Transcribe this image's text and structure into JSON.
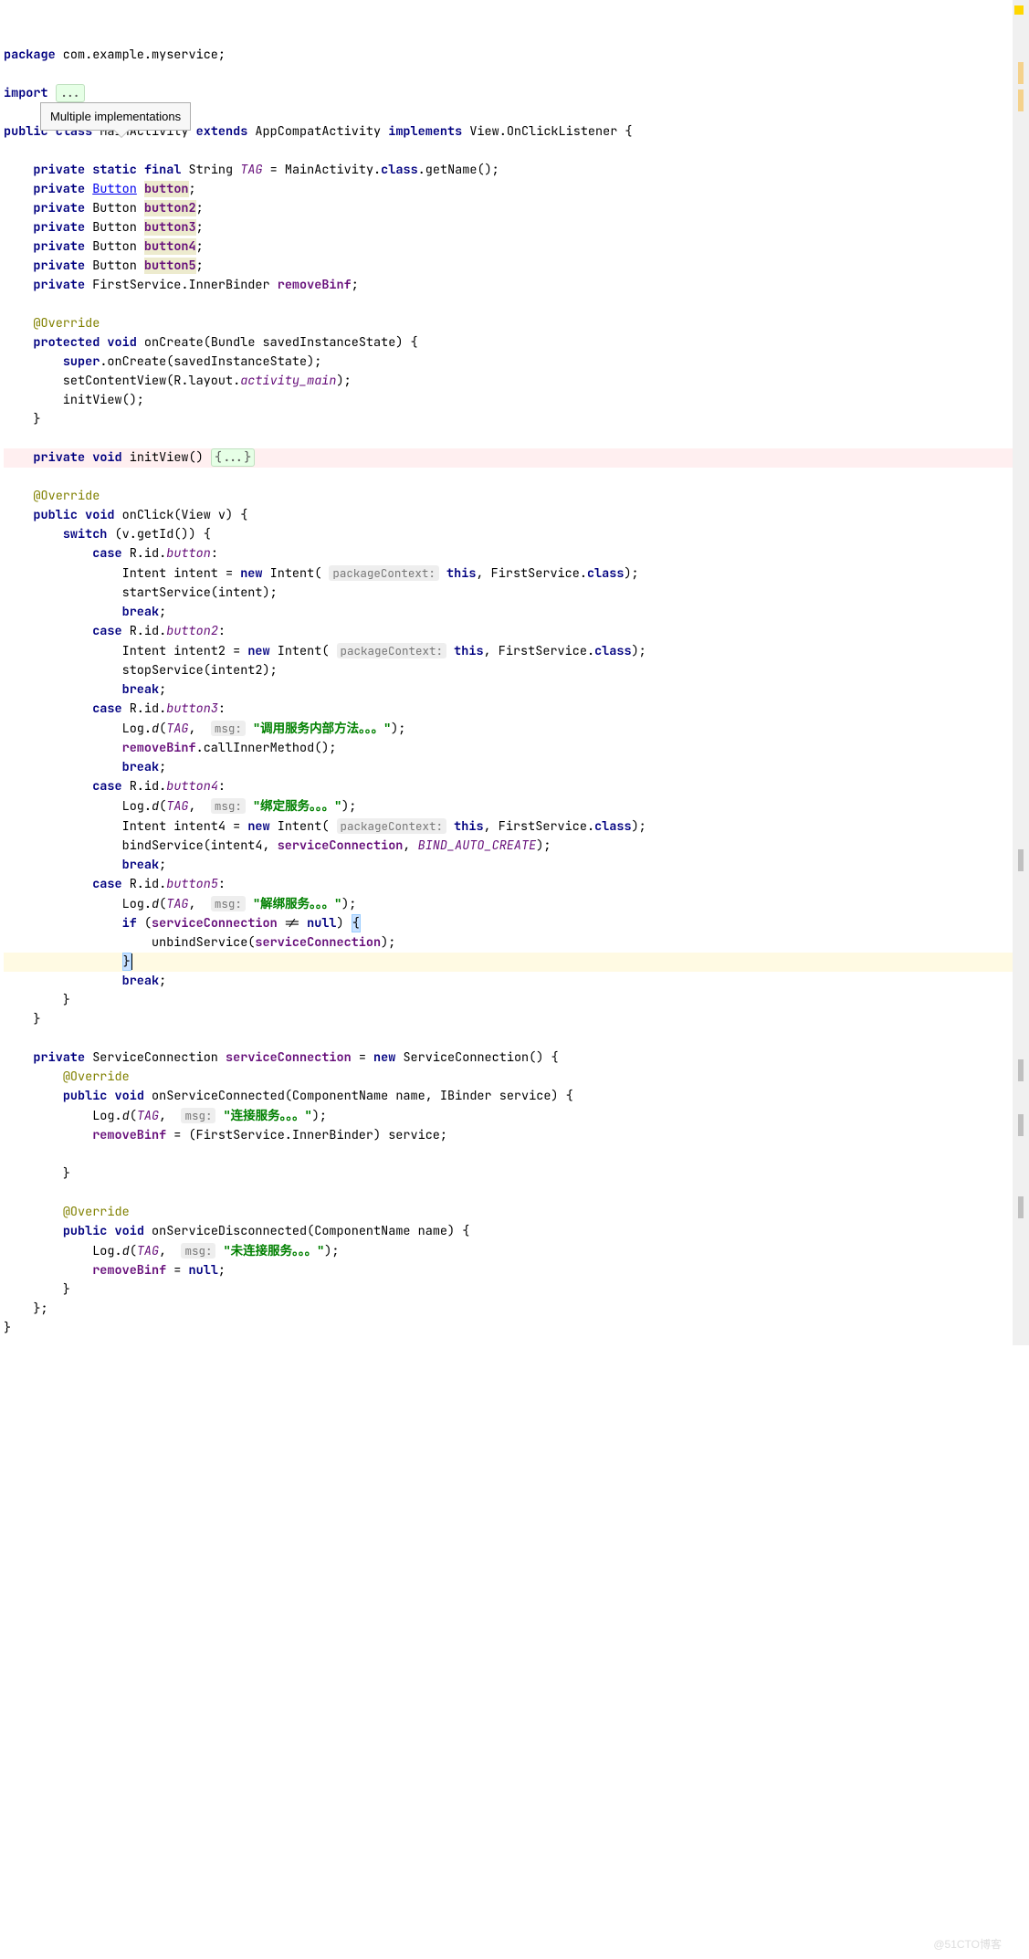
{
  "tooltip": "Multiple implementations",
  "code": {
    "pkg_kw": "package",
    "pkg": " com.example.myservice;",
    "import_kw": "import",
    "import_fold": "...",
    "l_class": {
      "public": "public",
      "class": "class",
      "name": " MainActivity ",
      "extends": "extends",
      "ext_name": " AppCompatActivity ",
      "implements": "implements",
      "impl_name": " View.OnClickListener {"
    },
    "f_tag": {
      "priv": "private",
      "stat": "static",
      "fin": "final",
      "type": " String ",
      "name": "TAG",
      "eq": " = MainActivity.",
      "cls": "class",
      "tail": ".getName();"
    },
    "f_button": {
      "priv": "private",
      "type": "Button",
      "name": "button",
      "semi": ";"
    },
    "f_button2": {
      "priv": "private",
      "type": " Button ",
      "name": "button2",
      "semi": ";"
    },
    "f_button3": {
      "priv": "private",
      "type": " Button ",
      "name": "button3",
      "semi": ";"
    },
    "f_button4": {
      "priv": "private",
      "type": " Button ",
      "name": "button4",
      "semi": ";"
    },
    "f_button5": {
      "priv": "private",
      "type": " Button ",
      "name": "button5",
      "semi": ";"
    },
    "f_binder": {
      "priv": "private",
      "type": " FirstService.InnerBinder ",
      "name": "removeBinf",
      "semi": ";"
    },
    "override": "@Override",
    "onCreate": {
      "prot": "protected",
      "void": "void",
      "sig": " onCreate(Bundle savedInstanceState) {"
    },
    "onCreate_super": {
      "super": "super",
      "tail": ".onCreate(savedInstanceState);"
    },
    "onCreate_scv": {
      "head": "        setContentView(R.layout.",
      "res": "activity_main",
      "tail": ");"
    },
    "onCreate_iv": "        initView();",
    "initView": {
      "priv": "private",
      "void": "void",
      "name": " initView() ",
      "fold": "{...}"
    },
    "onClick": {
      "pub": "public",
      "void": "void",
      "sig": " onClick(View v) {"
    },
    "switch": {
      "kw": "switch",
      "expr": " (v.getId()) {"
    },
    "case1": {
      "kw": "case",
      "r": " R.id.",
      "id": "button",
      "colon": ":"
    },
    "case1_intent": {
      "head": "                Intent intent = ",
      "new": "new",
      "mid": " Intent( ",
      "hint": "packageContext:",
      "this": "this",
      "tail": ", FirstService.",
      "cls": "class",
      "end": ");"
    },
    "case1_start": "                startService(intent);",
    "break": "break",
    "case2": {
      "kw": "case",
      "r": " R.id.",
      "id": "button2",
      "colon": ":"
    },
    "case2_intent": {
      "head": "                Intent intent2 = ",
      "new": "new",
      "mid": " Intent( ",
      "hint": "packageContext:",
      "this": "this",
      "tail": ", FirstService.",
      "cls": "class",
      "end": ");"
    },
    "case2_stop": "                stopService(intent2);",
    "case3": {
      "kw": "case",
      "r": " R.id.",
      "id": "button3",
      "colon": ":"
    },
    "log3": {
      "head": "                Log.",
      "d": "d",
      "p1": "(",
      "tag": "TAG",
      "comma": ",  ",
      "hint": "msg:",
      "sp": " ",
      "str": "\"调用服务内部方法。。。\"",
      "end": ");"
    },
    "case3_call": {
      "head": "                ",
      "obj": "removeBinf",
      "tail": ".callInnerMethod();"
    },
    "case4": {
      "kw": "case",
      "r": " R.id.",
      "id": "button4",
      "colon": ":"
    },
    "log4": {
      "head": "                Log.",
      "d": "d",
      "p1": "(",
      "tag": "TAG",
      "comma": ",  ",
      "hint": "msg:",
      "sp": " ",
      "str": "\"绑定服务。。。\"",
      "end": ");"
    },
    "case4_intent": {
      "head": "                Intent intent4 = ",
      "new": "new",
      "mid": " Intent( ",
      "hint": "packageContext:",
      "this": "this",
      "tail": ", FirstService.",
      "cls": "class",
      "end": ");"
    },
    "case4_bind": {
      "head": "                bindService(intent4, ",
      "sc": "serviceConnection",
      "mid": ", ",
      "flag": "BIND_AUTO_CREATE",
      "end": ");"
    },
    "case5": {
      "kw": "case",
      "r": " R.id.",
      "id": "button5",
      "colon": ":"
    },
    "log5": {
      "head": "                Log.",
      "d": "d",
      "p1": "(",
      "tag": "TAG",
      "comma": ",  ",
      "hint": "msg:",
      "sp": " ",
      "str": "\"解绑服务。。。\"",
      "end": ");"
    },
    "case5_if": {
      "head": "                ",
      "if": "if",
      "p": " (",
      "sc": "serviceConnection",
      "neq": " != ",
      "null": "null",
      "end": ") ",
      "brace": "{"
    },
    "case5_unbind": {
      "head": "                    unbindService(",
      "sc": "serviceConnection",
      "end": ");"
    },
    "case5_close_brace": "}",
    "sc_decl": {
      "priv": "private",
      "type": " ServiceConnection ",
      "name": "serviceConnection",
      "eq": " = ",
      "new": "new",
      "ctor": " ServiceConnection() {"
    },
    "sc_onConn": {
      "pub": "public",
      "void": "void",
      "sig": " onServiceConnected(ComponentName name, IBinder service) {"
    },
    "sc_log1": {
      "head": "            Log.",
      "d": "d",
      "p1": "(",
      "tag": "TAG",
      "comma": ",  ",
      "hint": "msg:",
      "sp": " ",
      "str": "\"连接服务。。。\"",
      "end": ");"
    },
    "sc_assign": {
      "head": "            ",
      "lhs": "removeBinf",
      "mid": " = (FirstService.InnerBinder) service;"
    },
    "sc_onDisc": {
      "pub": "public",
      "void": "void",
      "sig": " onServiceDisconnected(ComponentName name) {"
    },
    "sc_log2": {
      "head": "            Log.",
      "d": "d",
      "p1": "(",
      "tag": "TAG",
      "comma": ",  ",
      "hint": "msg:",
      "sp": " ",
      "str": "\"未连接服务。。。\"",
      "end": ");"
    },
    "sc_null": {
      "head": "            ",
      "lhs": "removeBinf",
      "mid": " = ",
      "null": "null",
      "end": ";"
    }
  },
  "watermark": "@51CTO博客"
}
